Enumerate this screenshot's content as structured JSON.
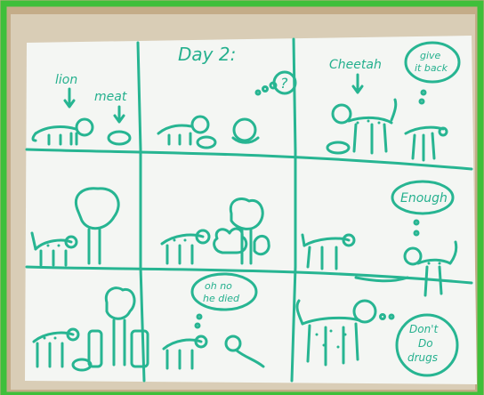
{
  "photo": {
    "frame_color": "#3fbf3a",
    "paper_color": "#f4f6f3",
    "ink_color": "#27b592",
    "table_color": "#c8b08c"
  },
  "comic": {
    "title": "Day 2:",
    "labels": {
      "lion": "lion",
      "meat": "meat",
      "cheetah": "Cheetah"
    },
    "bubbles": {
      "question": "?",
      "give_it_back": [
        "give",
        "it back"
      ],
      "enough": "Enough",
      "oh_no": [
        "oh no",
        "he died"
      ],
      "dont_do_drugs": [
        "Don't",
        "Do",
        "drugs"
      ]
    }
  }
}
